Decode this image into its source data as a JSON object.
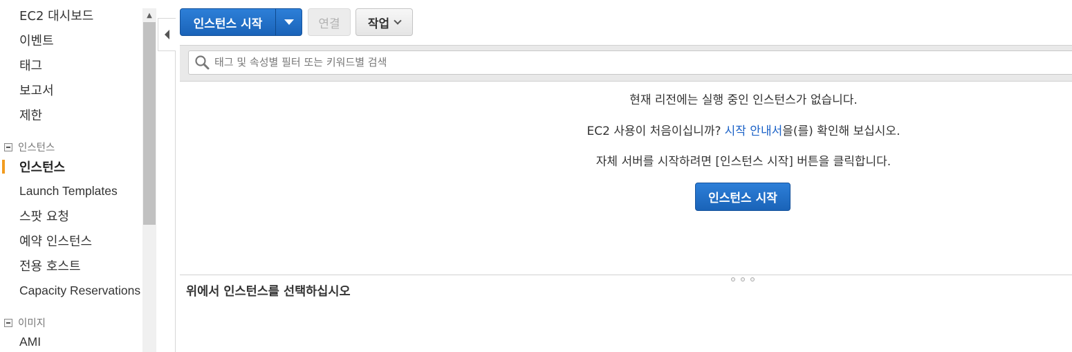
{
  "sidebar": {
    "items_top": [
      {
        "label": "EC2 대시보드"
      },
      {
        "label": "이벤트"
      },
      {
        "label": "태그"
      },
      {
        "label": "보고서"
      },
      {
        "label": "제한"
      }
    ],
    "sections": [
      {
        "header": "인스턴스",
        "items": [
          {
            "label": "인스턴스",
            "active": true
          },
          {
            "label": "Launch Templates"
          },
          {
            "label": "스팟 요청"
          },
          {
            "label": "예약 인스턴스"
          },
          {
            "label": "전용 호스트"
          },
          {
            "label": "Capacity Reservations"
          }
        ]
      },
      {
        "header": "이미지",
        "items": [
          {
            "label": "AMI"
          }
        ]
      }
    ],
    "active_color": "#f29c1f"
  },
  "toolbar": {
    "launch_label": "인스턴스 시작",
    "connect_label": "연결",
    "actions_label": "작업"
  },
  "search": {
    "placeholder": "태그 및 속성별 필터 또는 키워드별 검색"
  },
  "empty_state": {
    "line1": "현재 리전에는 실행 중인 인스턴스가 없습니다.",
    "line2_prefix": "EC2 사용이 처음이십니까?",
    "line2_link": "시작 안내서",
    "line2_suffix": "을(를) 확인해 보십시오.",
    "line3": "자체 서버를 시작하려면 [인스턴스 시작] 버튼을 클릭합니다.",
    "button_label": "인스턴스 시작"
  },
  "details_pane": {
    "title": "위에서 인스턴스를 선택하십시오"
  },
  "colors": {
    "primary": "#1a63b8",
    "link": "#1a61c7",
    "accent": "#f29c1f"
  }
}
